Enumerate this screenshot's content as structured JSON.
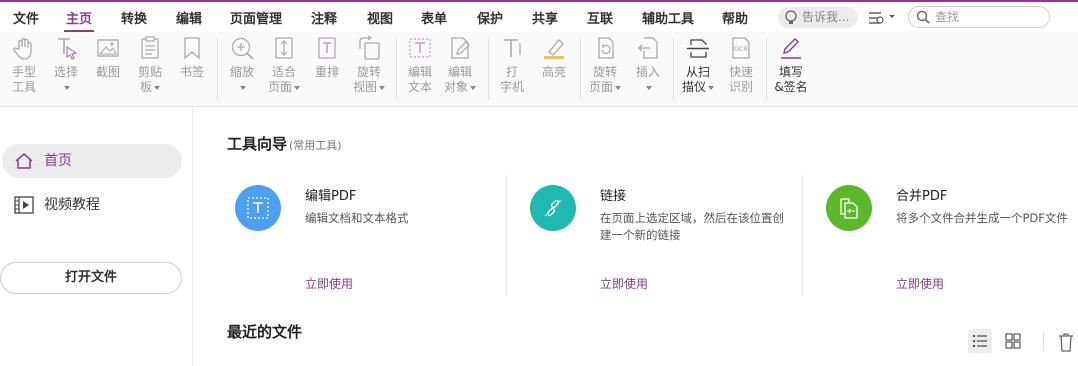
{
  "menu": {
    "items": [
      "文件",
      "主页",
      "转换",
      "编辑",
      "页面管理",
      "注释",
      "视图",
      "表单",
      "保护",
      "共享",
      "互联",
      "辅助工具",
      "帮助"
    ],
    "active": "主页",
    "tell_me_placeholder": "告诉我...",
    "search_placeholder": "查找"
  },
  "ribbon": {
    "tools": [
      {
        "l1": "手型",
        "l2": "工具",
        "icon": "hand-icon"
      },
      {
        "l1": "选择",
        "l2": "",
        "icon": "select-icon",
        "dropdown": true
      },
      {
        "l1": "截图",
        "l2": "",
        "icon": "snapshot-icon"
      },
      {
        "l1": "剪贴",
        "l2": "板",
        "icon": "clipboard-icon",
        "dropdown": true
      },
      {
        "l1": "书签",
        "l2": "",
        "icon": "bookmark-icon"
      },
      {
        "l1": "缩放",
        "l2": "",
        "icon": "zoom-icon",
        "dropdown": true
      },
      {
        "l1": "适合",
        "l2": "页面",
        "icon": "fit-page-icon",
        "dropdown": true
      },
      {
        "l1": "重排",
        "l2": "",
        "icon": "reflow-icon"
      },
      {
        "l1": "旋转",
        "l2": "视图",
        "icon": "rotate-view-icon",
        "dropdown": true
      },
      {
        "l1": "编辑",
        "l2": "文本",
        "icon": "edit-text-icon"
      },
      {
        "l1": "编辑",
        "l2": "对象",
        "icon": "edit-object-icon",
        "dropdown": true
      },
      {
        "l1": "打",
        "l2": "字机",
        "icon": "typewriter-icon"
      },
      {
        "l1": "高亮",
        "l2": "",
        "icon": "highlight-icon"
      },
      {
        "l1": "旋转",
        "l2": "页面",
        "icon": "rotate-page-icon",
        "dropdown": true
      },
      {
        "l1": "插入",
        "l2": "",
        "icon": "insert-icon",
        "dropdown": true
      },
      {
        "l1": "从扫",
        "l2": "描仪",
        "icon": "scanner-icon",
        "dropdown": true
      },
      {
        "l1": "快速",
        "l2": "识别",
        "icon": "ocr-icon"
      },
      {
        "l1": "填写",
        "l2": "&签名",
        "icon": "fill-sign-icon"
      }
    ]
  },
  "sidebar": {
    "items": [
      {
        "label": "首页"
      },
      {
        "label": "视频教程"
      }
    ],
    "open_file": "打开文件"
  },
  "main": {
    "tools_title": "工具向导",
    "tools_subtitle": "(常用工具)",
    "cards": [
      {
        "title": "编辑PDF",
        "desc": "编辑文档和文本格式",
        "action": "立即使用",
        "color": "#4d9ff2"
      },
      {
        "title": "链接",
        "desc": "在页面上选定区域，然后在该位置创建一个新的链接",
        "action": "立即使用",
        "color": "#1fb9b2"
      },
      {
        "title": "合并PDF",
        "desc": "将多个文件合并生成一个PDF文件",
        "action": "立即使用",
        "color": "#5ab82a"
      }
    ],
    "recent_title": "最近的文件"
  },
  "colors": {
    "accent": "#8a3b90"
  }
}
